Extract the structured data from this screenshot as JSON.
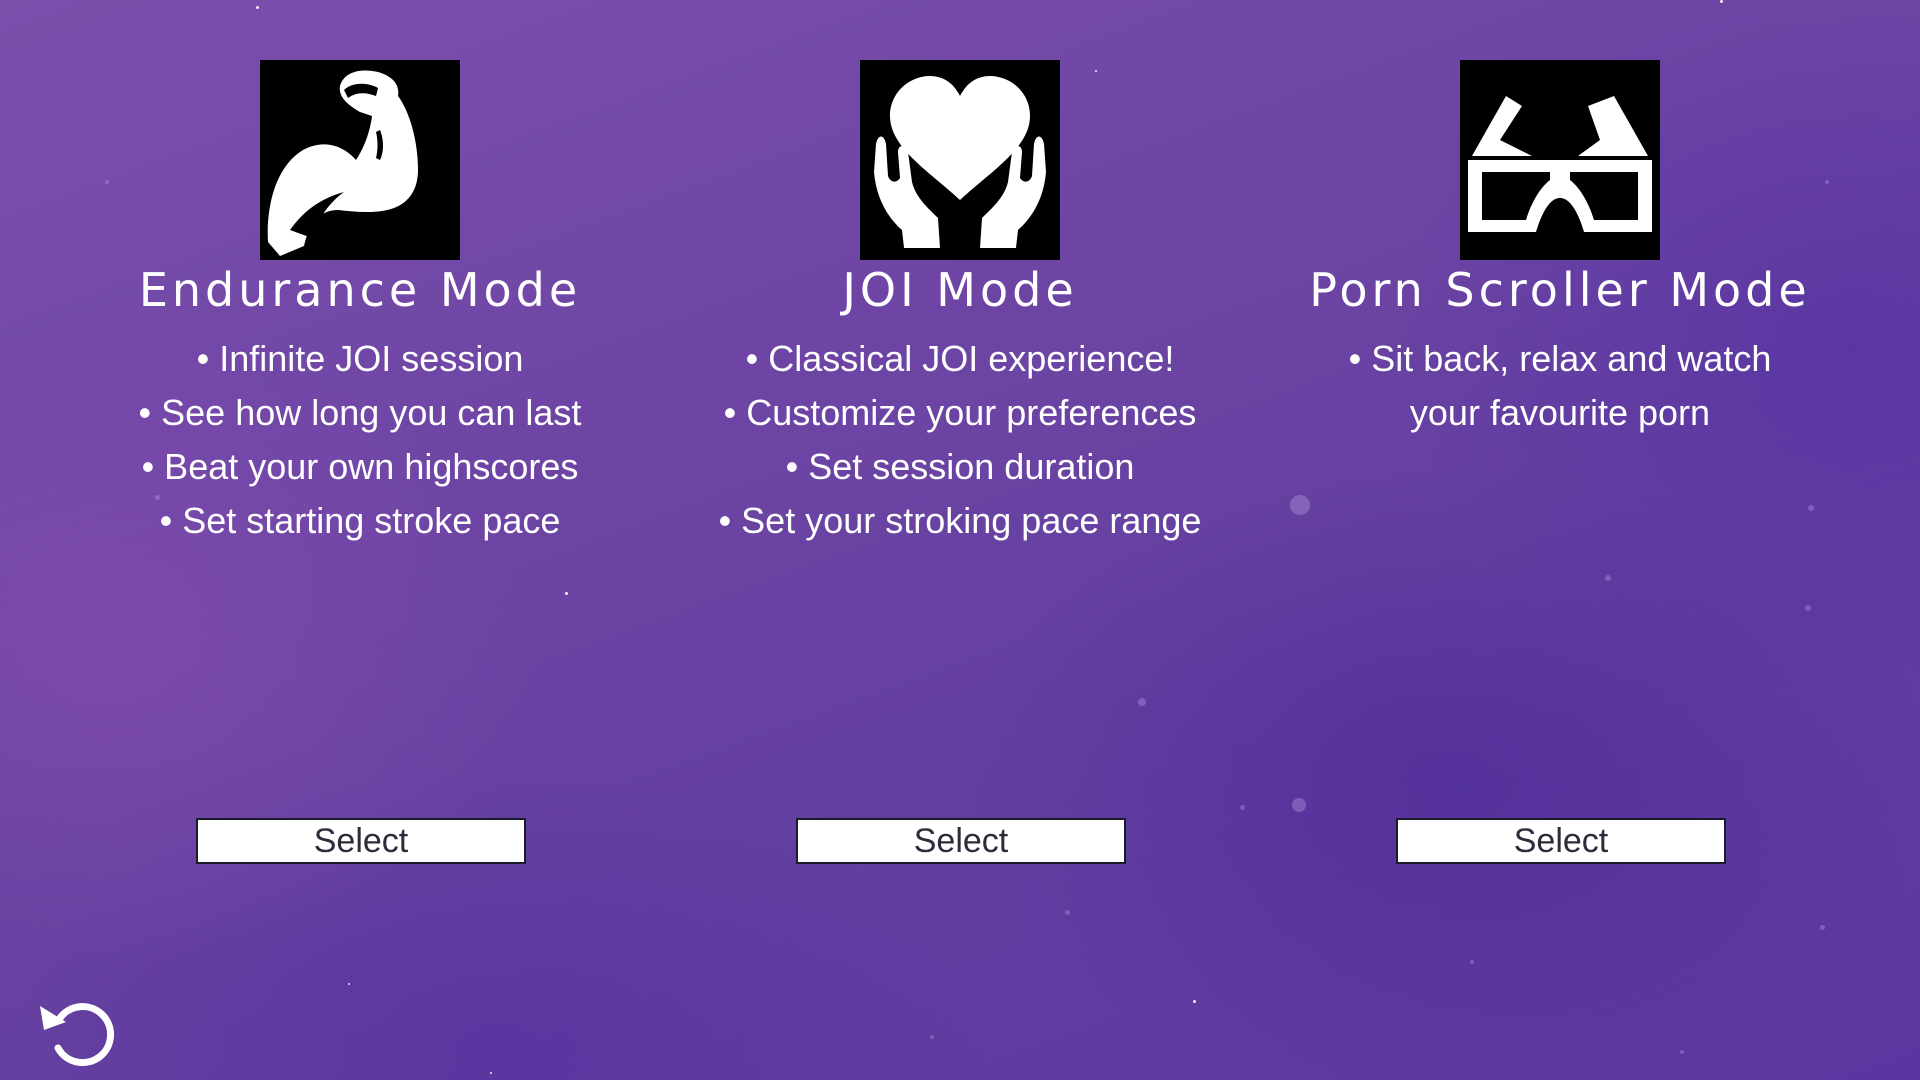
{
  "colors": {
    "background_top": "#7c4fad",
    "background_bottom": "#5a37a0",
    "text": "#ffffff",
    "icon_tile": "#000000",
    "button_bg": "#ffffff",
    "button_text": "#2c2c3a"
  },
  "modes": [
    {
      "icon": "flexed-bicep-icon",
      "title": "Endurance Mode",
      "features": [
        "• Infinite JOI session",
        "• See how long you can last",
        "• Beat your own highscores",
        "• Set starting stroke pace"
      ],
      "select_label": "Select"
    },
    {
      "icon": "heart-in-hands-icon",
      "title": "JOI Mode",
      "features": [
        "• Classical JOI experience!",
        "• Customize your preferences",
        "• Set session duration",
        "• Set your stroking pace range"
      ],
      "select_label": "Select"
    },
    {
      "icon": "3d-glasses-icon",
      "title": "Porn Scroller Mode",
      "features": [
        "• Sit back, relax and watch",
        "your favourite porn"
      ],
      "select_label": "Select"
    }
  ],
  "footer": {
    "back_icon": "undo-arrow-icon"
  }
}
